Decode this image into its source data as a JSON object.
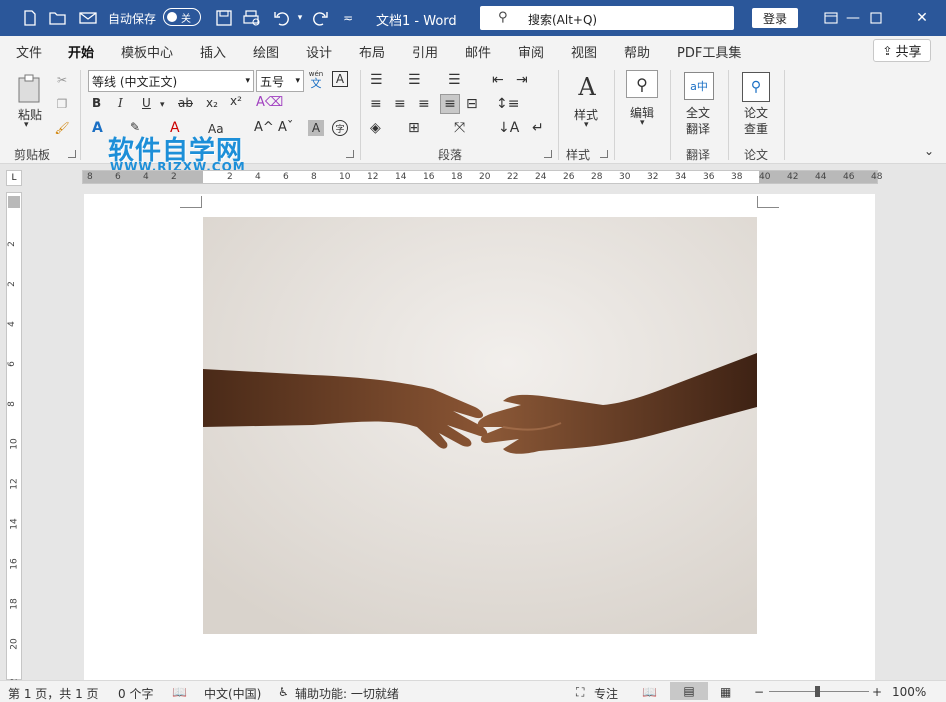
{
  "titlebar": {
    "autosave_label": "自动保存",
    "autosave_state": "关",
    "document_title": "文档1  -  Word",
    "search_placeholder": "搜索(Alt+Q)",
    "login_label": "登录"
  },
  "tabs": [
    "文件",
    "开始",
    "模板中心",
    "插入",
    "绘图",
    "设计",
    "布局",
    "引用",
    "邮件",
    "审阅",
    "视图",
    "帮助",
    "PDF工具集"
  ],
  "active_tab": "开始",
  "share_label": "共享",
  "ribbon": {
    "paste_label": "粘贴",
    "clipboard_group": "剪贴板",
    "font_name": "等线 (中文正文)",
    "font_size": "五号",
    "wen_top": "wén",
    "wen_char": "文",
    "a_box": "A",
    "bold": "B",
    "italic": "I",
    "underline": "U",
    "strike": "ab",
    "subscript": "x₂",
    "superscript": "x²",
    "grow_font": "A^",
    "shrink_font": "Aˇ",
    "char_shading": "A",
    "enclose_char": "字",
    "change_case": "Aa",
    "paragraph_group": "段落",
    "styles_label": "样式",
    "styles_group": "样式",
    "edit_label": "编辑",
    "translate_label_1": "全文",
    "translate_label_2": "翻译",
    "translate_group": "翻译",
    "paper_label_1": "论文",
    "paper_label_2": "查重",
    "paper_group": "论文"
  },
  "watermark": {
    "title": "软件自学网",
    "url": "WWW.RJZXW.COM"
  },
  "ruler": {
    "h_ticks": [
      "8",
      "6",
      "4",
      "2",
      "",
      "2",
      "4",
      "6",
      "8",
      "10",
      "12",
      "14",
      "16",
      "18",
      "20",
      "22",
      "24",
      "26",
      "28",
      "30",
      "32",
      "34",
      "36",
      "38",
      "40",
      "42",
      "44",
      "46",
      "48"
    ],
    "v_ticks": [
      "2",
      "",
      "2",
      "",
      "4",
      "",
      "6",
      "",
      "8",
      "",
      "10",
      "",
      "12",
      "",
      "14",
      "",
      "16",
      "",
      "18",
      "",
      "20",
      "",
      "22"
    ]
  },
  "statusbar": {
    "page_info": "第 1 页，共 1 页",
    "word_count": "0 个字",
    "language": "中文(中国)",
    "accessibility": "辅助功能: 一切就绪",
    "focus": "专注",
    "zoom_percent": "100%",
    "zoom_level": 1.0
  },
  "colors": {
    "titlebar": "#2b579a",
    "ribbon": "#f3f3f3",
    "watermark": "#1d8fd8"
  }
}
